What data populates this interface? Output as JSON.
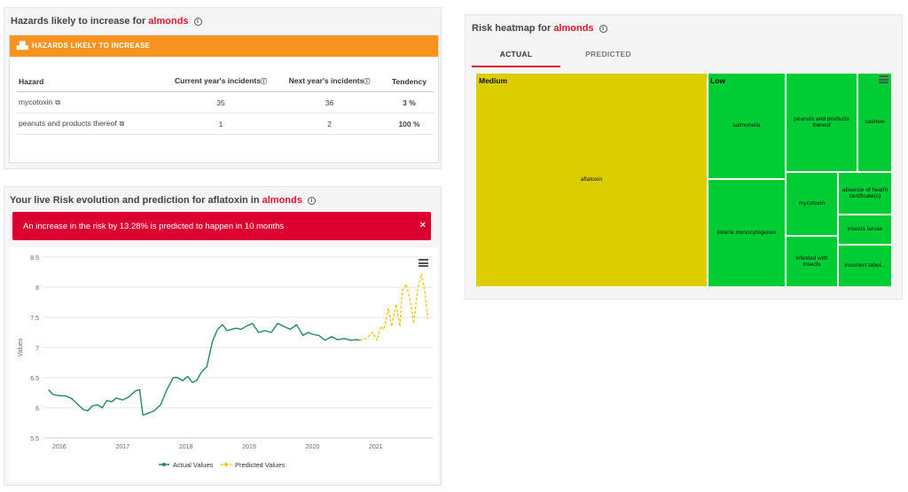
{
  "hazards_panel": {
    "title_prefix": "Hazards likely to increase for",
    "title_highlight": "almonds",
    "bar_label": "HAZARDS LIKELY TO INCREASE",
    "columns": [
      "Hazard",
      "Current year's incidents",
      "Next year's incidents",
      "Tendency"
    ],
    "rows": [
      {
        "hazard": "mycotoxin",
        "current": "35",
        "next": "36",
        "tendency": "3 %"
      },
      {
        "hazard": "peanuts and products thereof",
        "current": "1",
        "next": "2",
        "tendency": "100 %"
      }
    ]
  },
  "evolution_panel": {
    "title_prefix": "Your live Risk evolution and prediction for aflatoxin in",
    "title_highlight": "almonds",
    "alert_text": "An increase in the risk by 13.28% is predicted to happen in 10 months",
    "alert_close": "×"
  },
  "heatmap_panel": {
    "title_prefix": "Risk heatmap for",
    "title_highlight": "almonds",
    "tabs": [
      "ACTUAL",
      "PREDICTED"
    ],
    "active_tab": "ACTUAL",
    "groups": [
      {
        "name": "Medium",
        "color": "#dccd00",
        "items": [
          "aflatoxin"
        ]
      },
      {
        "name": "Low",
        "color": "#00cc33",
        "items": [
          "salmonella",
          "peanuts and products thereof",
          "cashew",
          "listeria monocytogenes",
          "mycotoxin",
          "absence of health certificate(s)",
          "insects larvae",
          "infested with insects",
          "incorrect label..."
        ]
      }
    ]
  },
  "colors": {
    "accent_red": "#e0142e",
    "orange": "#f7931e",
    "actual_line": "#1e8a5a",
    "predicted_line": "#f5c518",
    "medium": "#dccd00",
    "low": "#00cc33"
  },
  "chart_data": {
    "type": "line",
    "title": "",
    "ylabel": "Values",
    "xlabel": "",
    "ylim": [
      5.5,
      8.5
    ],
    "y_ticks": [
      "5.5",
      "6",
      "6.5",
      "7",
      "7.5",
      "8",
      "8.5"
    ],
    "x_ticks": [
      "2016",
      "2017",
      "2018",
      "2019",
      "2020",
      "2021"
    ],
    "legend": [
      "Actual Values",
      "Predicted Values"
    ],
    "legend_position": "bottom",
    "grid": true,
    "series": [
      {
        "name": "Actual Values",
        "x": [
          2015.83,
          2015.9,
          2016.0,
          2016.1,
          2016.2,
          2016.3,
          2016.38,
          2016.45,
          2016.52,
          2016.6,
          2016.68,
          2016.75,
          2016.83,
          2016.9,
          2017.0,
          2017.1,
          2017.2,
          2017.27,
          2017.32,
          2017.38,
          2017.5,
          2017.6,
          2017.7,
          2017.8,
          2017.87,
          2017.95,
          2018.03,
          2018.1,
          2018.17,
          2018.25,
          2018.33,
          2018.42,
          2018.5,
          2018.58,
          2018.65,
          2018.72,
          2018.8,
          2018.87,
          2018.95,
          2019.05,
          2019.15,
          2019.25,
          2019.35,
          2019.45,
          2019.55,
          2019.65,
          2019.75,
          2019.85,
          2019.93,
          2020.0,
          2020.1,
          2020.2,
          2020.3,
          2020.4,
          2020.5,
          2020.6,
          2020.7,
          2020.75
        ],
        "values": [
          6.3,
          6.22,
          6.2,
          6.2,
          6.15,
          6.05,
          5.97,
          5.95,
          6.03,
          6.05,
          6.0,
          6.12,
          6.1,
          6.16,
          6.13,
          6.18,
          6.28,
          6.3,
          5.88,
          5.9,
          5.95,
          6.05,
          6.3,
          6.5,
          6.5,
          6.45,
          6.52,
          6.42,
          6.45,
          6.6,
          6.68,
          7.1,
          7.3,
          7.38,
          7.28,
          7.3,
          7.32,
          7.3,
          7.35,
          7.4,
          7.25,
          7.28,
          7.25,
          7.4,
          7.35,
          7.3,
          7.38,
          7.2,
          7.25,
          7.22,
          7.2,
          7.12,
          7.18,
          7.13,
          7.15,
          7.12,
          7.13,
          7.12
        ]
      },
      {
        "name": "Predicted Values",
        "x": [
          2020.75,
          2020.85,
          2020.95,
          2021.02,
          2021.08,
          2021.13,
          2021.2,
          2021.25,
          2021.32,
          2021.38,
          2021.42,
          2021.48,
          2021.55,
          2021.6,
          2021.66,
          2021.72,
          2021.78,
          2021.82
        ],
        "values": [
          7.12,
          7.15,
          7.25,
          7.12,
          7.35,
          7.3,
          7.65,
          7.35,
          7.72,
          7.35,
          7.95,
          8.05,
          7.75,
          7.4,
          7.95,
          8.22,
          7.9,
          7.48
        ]
      }
    ]
  }
}
